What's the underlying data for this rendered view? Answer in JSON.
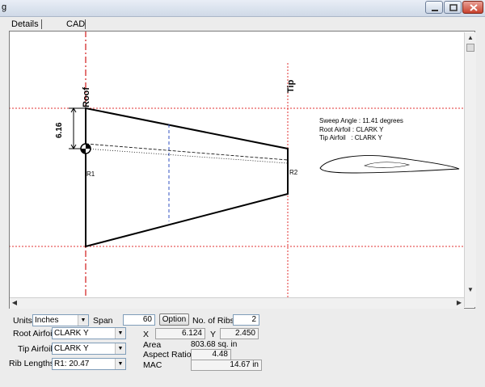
{
  "window": {
    "title": "g"
  },
  "tabs": [
    {
      "label": "Details"
    },
    {
      "label": "CAD"
    }
  ],
  "drawing": {
    "root_label": "Roof",
    "tip_label": "Tip",
    "chord_dimension": "6.16",
    "rib_label_root": "R1",
    "rib_label_tip": "R2",
    "info": {
      "sweep": "Sweep Angle : 11.41 degrees",
      "root_airfoil": "Root Airfoil : CLARK Y",
      "tip_airfoil": "Tip Airfoil   : CLARK Y"
    }
  },
  "controls": {
    "units_label": "Units",
    "units_value": "Inches",
    "span_label": "Span",
    "span_value": "60",
    "option_label": "Option",
    "ribs_label": "No. of Ribs",
    "ribs_value": "2",
    "root_airfoil_label": "Root Airfoil",
    "root_airfoil_value": "CLARK Y",
    "tip_airfoil_label": "Tip Airfoil",
    "tip_airfoil_value": "CLARK Y",
    "rib_lengths_label": "Rib Lengths",
    "rib_lengths_value": "R1: 20.47",
    "x_label": "X",
    "x_value": "6.124",
    "y_label": "Y",
    "y_value": "2.450",
    "area_label": "Area",
    "area_value": "803.68 sq. in",
    "aspect_label": "Aspect Ratio",
    "aspect_value": "4.48",
    "mac_label": "MAC",
    "mac_value": "14.67 in"
  }
}
